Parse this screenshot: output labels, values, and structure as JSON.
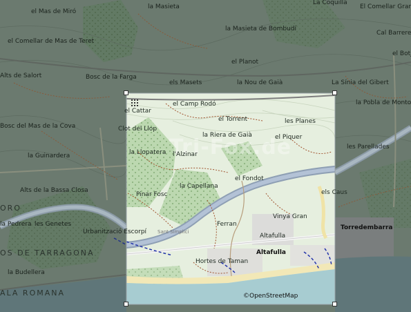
{
  "map": {
    "watermark": "Tri-Fox.de",
    "attribution": "©OpenStreetMap",
    "labels": {
      "la_masieta": "la Masieta",
      "la_coquilla": "La Coquilla",
      "el_comellar_gran": "El Comellar Gran",
      "el_mas_de_miro": "el Mas de Miró",
      "el_comellar_de_mas_de_teret": "el Comellar de Mas de Teret",
      "la_masieta_de_bombudi": "la Masieta de Bombudí",
      "cal_barreres": "Cal Barreres",
      "el_botja": "el Botja",
      "el_planot": "el Planot",
      "bosc_de_la_farga": "Bosc de la Farga",
      "alts_de_salort": "Alts de Salort",
      "els_masets": "els Masets",
      "la_nou_de_gaia": "la Nou de Gaià",
      "la_sinia_del_gibert": "La Sínia del Gibert",
      "la_pobla_de_montornes": "la Pobla de Montornès",
      "el_camp_rodo": "el Camp Rodó",
      "el_cattar": "el Cattar",
      "el_torrent": "el Torrent",
      "les_planes": "les Planes",
      "bosc_del_mas_de_la_cova": "Bosc del Mas de la Cova",
      "clot_del_llop": "Clot del Llop",
      "la_riera_de_gaia": "la Riera de Gaià",
      "el_piquer": "el Piquer",
      "la_guinardera": "la Guinardera",
      "la_llopatera": "la Llopatera",
      "l_alzinar": "l'Alzinar",
      "les_parellades": "les Parellades",
      "la_capellana": "la Capellana",
      "el_fondot": "el Fondot",
      "alts_de_la_bassa_closa": "Alts de la Bassa Closa",
      "els_caus": "els Caus",
      "pinar_fosc": "Pinar Fosc",
      "oro": "ORO",
      "la_pedrera": "la Pedrera",
      "les_genetes": "les Genetes",
      "ferran": "Ferran",
      "vinya_gran": "Vinya Gran",
      "torredembarra": "Torredembarra",
      "urbanitzacio_escorpi": "Urbanització Escorpí",
      "sant_simplici": "Sant Simplici",
      "altafulla_area": "Altafulla",
      "altafulla_town": "Altafulla",
      "os_de_tarragona": "OS DE TARRAGONA",
      "hortes_de_taman": "Hortes de Taman",
      "la_budellera": "la Budellera",
      "ala_romana": "ALA ROMANA"
    }
  }
}
